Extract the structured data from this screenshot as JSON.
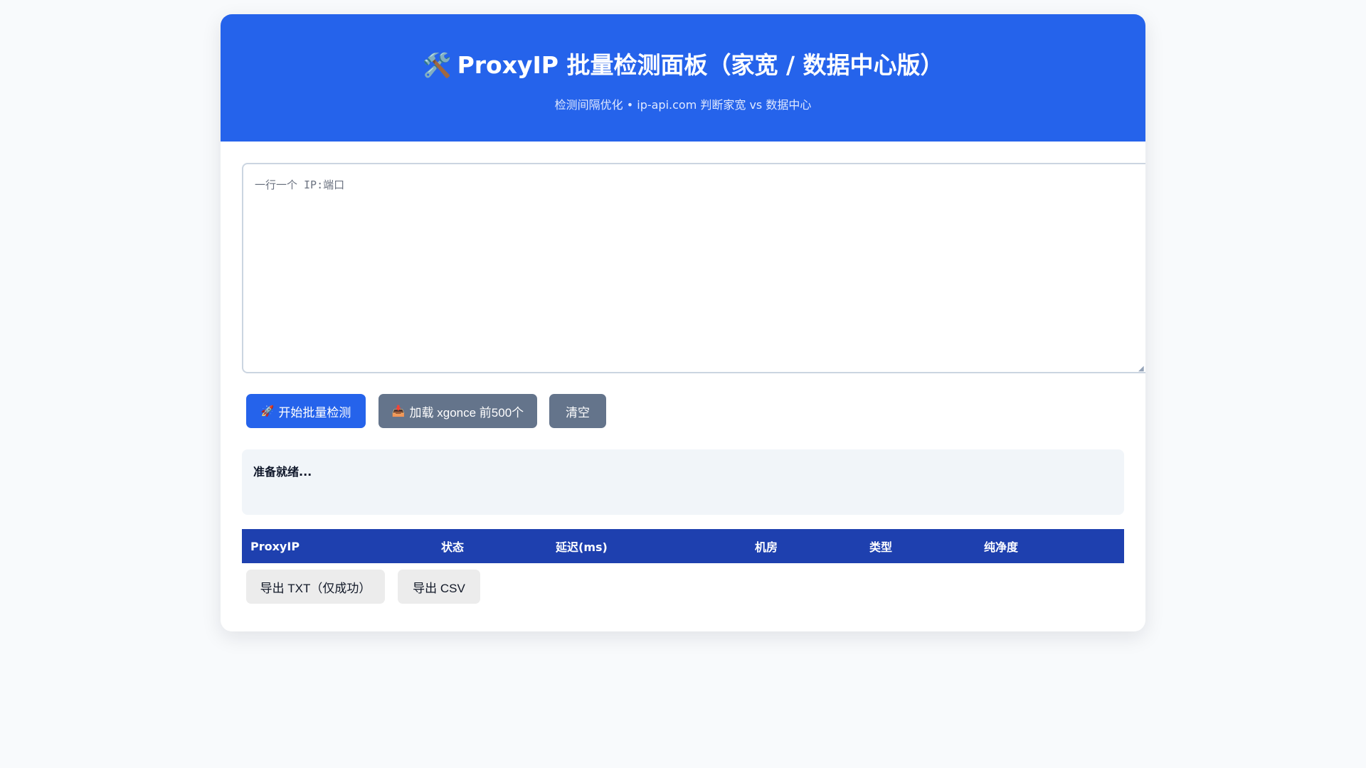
{
  "header": {
    "title_icon": "🛠️",
    "title": "ProxyIP 批量检测面板（家宽 / 数据中心版）",
    "subtitle": "检测间隔优化 • ip-api.com 判断家宽 vs 数据中心"
  },
  "input": {
    "value": "",
    "placeholder": "一行一个 IP:端口"
  },
  "actions": {
    "start_icon": "🚀",
    "start_label": "开始批量检测",
    "load_icon": "📥",
    "load_label": "加载 xgonce 前500个",
    "clear_label": "清空"
  },
  "status": {
    "text": "准备就绪..."
  },
  "table": {
    "columns": [
      "ProxyIP",
      "状态",
      "延迟(ms)",
      "机房",
      "类型",
      "纯净度"
    ],
    "rows": []
  },
  "export": {
    "txt_label": "导出 TXT（仅成功）",
    "csv_label": "导出 CSV"
  },
  "colors": {
    "primary": "#2563eb",
    "table_header": "#1e40af",
    "secondary_button": "#64748b",
    "background": "#f8fafc"
  }
}
